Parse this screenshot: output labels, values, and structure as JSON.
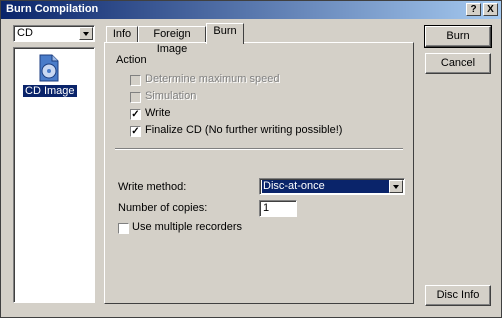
{
  "window": {
    "title": "Burn Compilation",
    "help_glyph": "?",
    "close_glyph": "X"
  },
  "drive_select": {
    "value": "CD"
  },
  "sidebar": {
    "items": [
      {
        "label": "CD Image",
        "icon": "cd-image-icon",
        "selected": true
      }
    ]
  },
  "tabs": [
    {
      "label": "Info",
      "active": false
    },
    {
      "label": "Foreign Image",
      "active": false
    },
    {
      "label": "Burn",
      "active": true
    }
  ],
  "action": {
    "heading": "Action",
    "options": [
      {
        "label": "Determine maximum speed",
        "checked": false,
        "enabled": false
      },
      {
        "label": "Simulation",
        "checked": false,
        "enabled": false
      },
      {
        "label": "Write",
        "checked": true,
        "enabled": true
      },
      {
        "label": "Finalize CD (No further writing possible!)",
        "checked": true,
        "enabled": true
      }
    ]
  },
  "write_method": {
    "label": "Write method:",
    "value": "Disc-at-once"
  },
  "copies": {
    "label": "Number of copies:",
    "value": "1"
  },
  "multiple_recorders": {
    "label": "Use multiple recorders",
    "checked": false
  },
  "buttons": {
    "burn": "Burn",
    "cancel": "Cancel",
    "disc_info": "Disc Info"
  },
  "colors": {
    "titlebar_start": "#0a246a",
    "titlebar_end": "#a6caf0",
    "face": "#d4d0c8",
    "selection": "#0a246a"
  }
}
